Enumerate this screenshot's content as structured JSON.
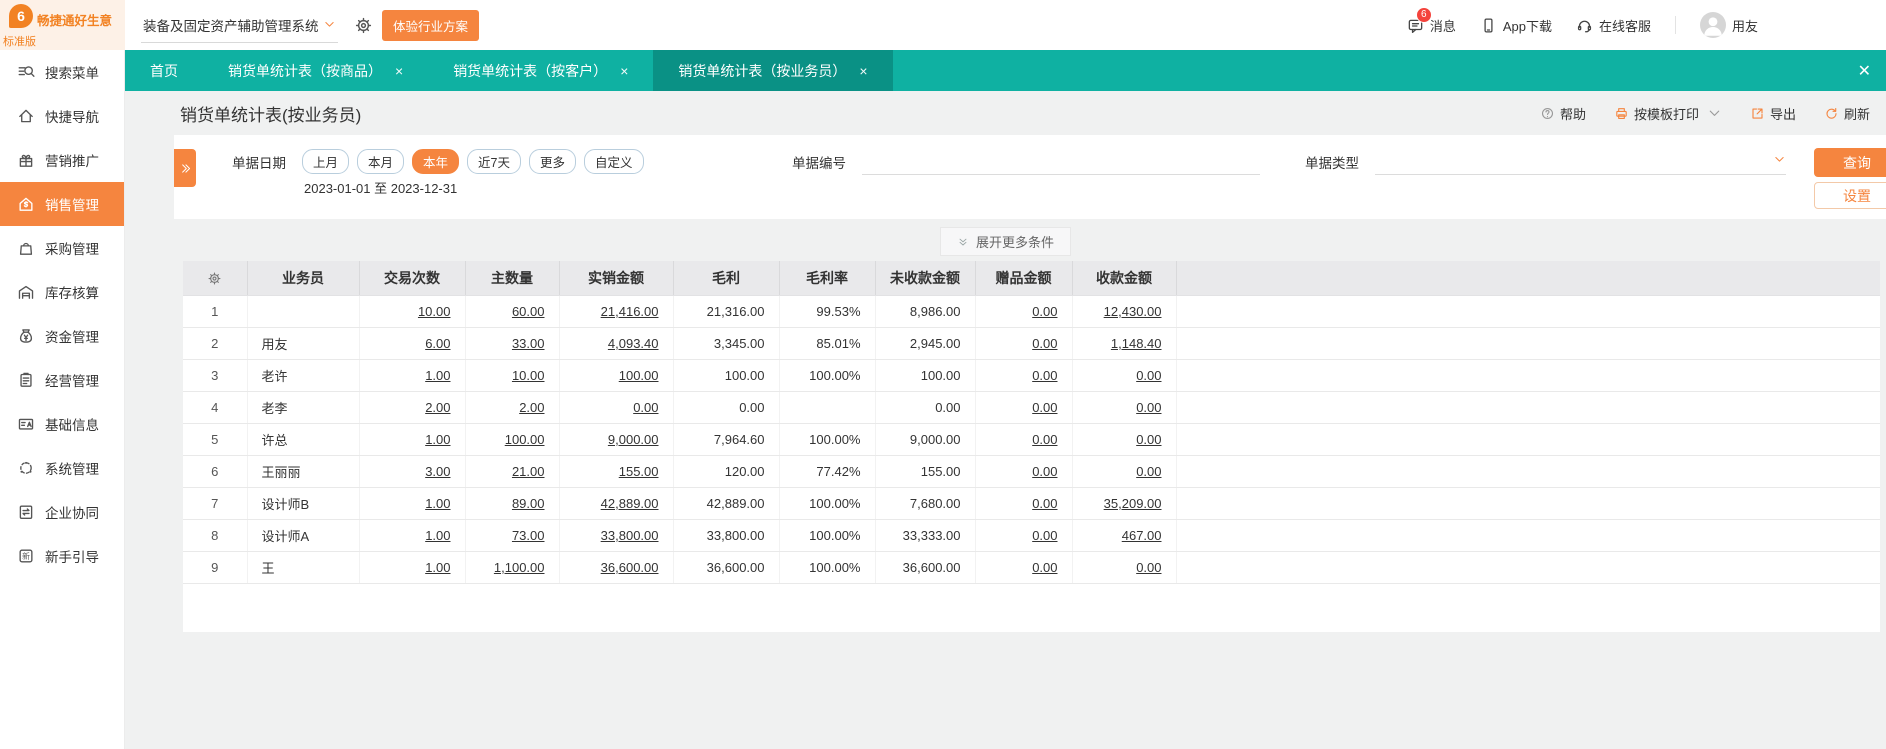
{
  "topbar": {
    "logo": {
      "title": "畅捷通好生意",
      "subtitle": "标准版",
      "mark": "6"
    },
    "system_select": {
      "value": "装备及固定资产辅助管理系统",
      "icon": "chevron-down-icon"
    },
    "settings_icon": "gear-icon",
    "trial_button": "体验行业方案",
    "message": {
      "label": "消息",
      "badge": "6",
      "icon": "message-icon"
    },
    "app_download": {
      "label": "App下载",
      "icon": "phone-icon"
    },
    "online_service": {
      "label": "在线客服",
      "icon": "headset-icon"
    },
    "user": {
      "label": "用友",
      "icon": "avatar-icon"
    }
  },
  "tab_bar": {
    "tabs": [
      {
        "label": "首页",
        "closable": false,
        "active": false
      },
      {
        "label": "销货单统计表（按商品）",
        "closable": true,
        "active": false
      },
      {
        "label": "销货单统计表（按客户）",
        "closable": true,
        "active": false
      },
      {
        "label": "销货单统计表（按业务员）",
        "closable": true,
        "active": true
      }
    ],
    "close_all": "✕"
  },
  "sidebar": {
    "items": [
      {
        "label": "搜索菜单",
        "icon": "search-icon",
        "active": false
      },
      {
        "label": "快捷导航",
        "icon": "home-icon",
        "active": false
      },
      {
        "label": "营销推广",
        "icon": "gift-icon",
        "active": false
      },
      {
        "label": "销售管理",
        "icon": "sales-icon",
        "active": true
      },
      {
        "label": "采购管理",
        "icon": "bag-icon",
        "active": false
      },
      {
        "label": "库存核算",
        "icon": "warehouse-icon",
        "active": false
      },
      {
        "label": "资金管理",
        "icon": "moneybag-icon",
        "active": false
      },
      {
        "label": "经营管理",
        "icon": "clipboard-icon",
        "active": false
      },
      {
        "label": "基础信息",
        "icon": "idcard-icon",
        "active": false
      },
      {
        "label": "系统管理",
        "icon": "system-icon",
        "active": false
      },
      {
        "label": "企业协同",
        "icon": "collab-icon",
        "active": false
      },
      {
        "label": "新手引导",
        "icon": "guide-icon",
        "active": false
      }
    ]
  },
  "page": {
    "title": "销货单统计表(按业务员)",
    "toolbar": {
      "help": {
        "label": "帮助",
        "icon": "help-icon"
      },
      "print": {
        "label": "按模板打印",
        "icon": "print-icon",
        "dropdown_icon": "chevron-down-icon"
      },
      "export": {
        "label": "导出",
        "icon": "export-icon"
      },
      "refresh": {
        "label": "刷新",
        "icon": "refresh-icon"
      }
    }
  },
  "filters": {
    "collapse_icon": "double-chevron-right-icon",
    "date": {
      "label": "单据日期",
      "options": [
        "上月",
        "本月",
        "本年",
        "近7天",
        "更多",
        "自定义"
      ],
      "selected": "本年",
      "range": "2023-01-01 至 2023-12-31"
    },
    "doc_no": {
      "label": "单据编号",
      "value": "",
      "placeholder": ""
    },
    "doc_type": {
      "label": "单据类型",
      "value": "",
      "icon": "chevron-down-icon"
    },
    "search_button": "查询",
    "settings_button": "设置",
    "expand_more": {
      "label": "展开更多条件",
      "icon": "double-chevron-down-icon"
    }
  },
  "table": {
    "settings_icon": "gear-icon",
    "columns": [
      "业务员",
      "交易次数",
      "主数量",
      "实销金额",
      "毛利",
      "毛利率",
      "未收款金额",
      "赠品金额",
      "收款金额"
    ],
    "link_columns": [
      true,
      true,
      true,
      false,
      false,
      false,
      true,
      true
    ],
    "rows": [
      {
        "no": "1",
        "name": "",
        "values": [
          "10.00",
          "60.00",
          "21,416.00",
          "21,316.00",
          "99.53%",
          "8,986.00",
          "0.00",
          "12,430.00"
        ]
      },
      {
        "no": "2",
        "name": "用友",
        "values": [
          "6.00",
          "33.00",
          "4,093.40",
          "3,345.00",
          "85.01%",
          "2,945.00",
          "0.00",
          "1,148.40"
        ]
      },
      {
        "no": "3",
        "name": "老许",
        "values": [
          "1.00",
          "10.00",
          "100.00",
          "100.00",
          "100.00%",
          "100.00",
          "0.00",
          "0.00"
        ]
      },
      {
        "no": "4",
        "name": "老李",
        "values": [
          "2.00",
          "2.00",
          "0.00",
          "0.00",
          "",
          "0.00",
          "0.00",
          "0.00"
        ]
      },
      {
        "no": "5",
        "name": "许总",
        "values": [
          "1.00",
          "100.00",
          "9,000.00",
          "7,964.60",
          "100.00%",
          "9,000.00",
          "0.00",
          "0.00"
        ]
      },
      {
        "no": "6",
        "name": "王丽丽",
        "values": [
          "3.00",
          "21.00",
          "155.00",
          "120.00",
          "77.42%",
          "155.00",
          "0.00",
          "0.00"
        ]
      },
      {
        "no": "7",
        "name": "设计师B",
        "values": [
          "1.00",
          "89.00",
          "42,889.00",
          "42,889.00",
          "100.00%",
          "7,680.00",
          "0.00",
          "35,209.00"
        ]
      },
      {
        "no": "8",
        "name": "设计师A",
        "values": [
          "1.00",
          "73.00",
          "33,800.00",
          "33,800.00",
          "100.00%",
          "33,333.00",
          "0.00",
          "467.00"
        ]
      },
      {
        "no": "9",
        "name": "王",
        "values": [
          "1.00",
          "1,100.00",
          "36,600.00",
          "36,600.00",
          "100.00%",
          "36,600.00",
          "0.00",
          "0.00"
        ]
      }
    ]
  },
  "colors": {
    "accent_orange": "#f5853f",
    "teal": "#0fb1a2",
    "teal_active": "#0a9185",
    "badge_red": "#f4433c",
    "header_gray": "#e9e9eb"
  }
}
